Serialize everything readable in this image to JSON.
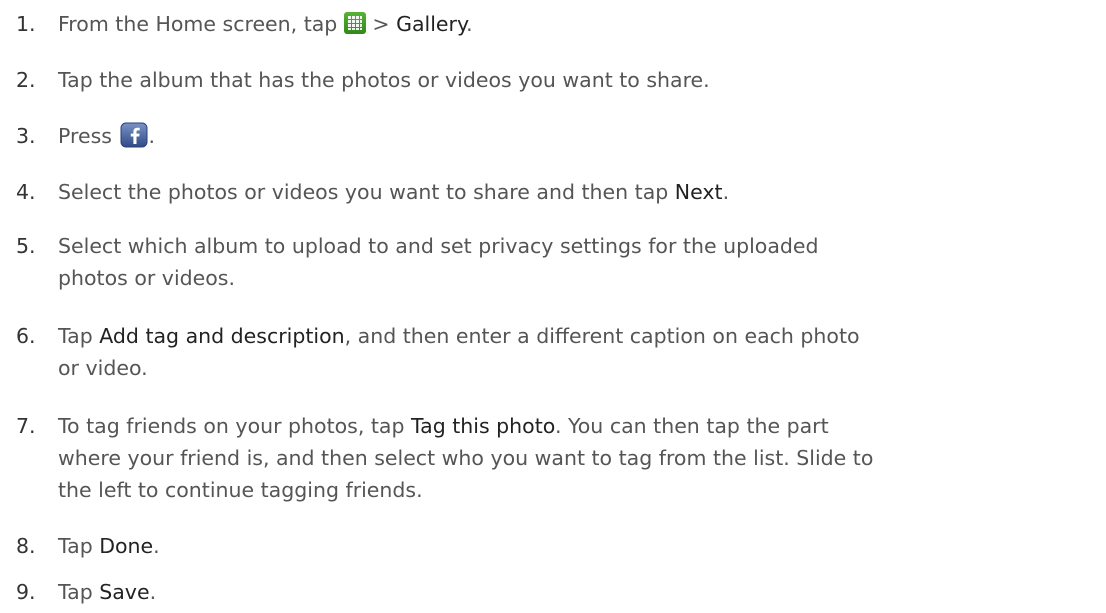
{
  "steps": [
    {
      "num": "1.",
      "t1": "From the Home screen, tap ",
      "icon": "app-grid-icon",
      "t2": " > ",
      "kw1": "Gallery",
      "t3": "."
    },
    {
      "num": "2.",
      "t1": "Tap the album that has the photos or videos you want to share."
    },
    {
      "num": "3.",
      "t1": "Press ",
      "icon": "facebook-icon",
      "t2": "."
    },
    {
      "num": "4.",
      "t1": "Select the photos or videos you want to share and then tap ",
      "kw1": "Next",
      "t2": "."
    },
    {
      "num": "5.",
      "line1": "Select which album to upload to and set privacy settings for the uploaded",
      "line2": "photos or videos."
    },
    {
      "num": "6.",
      "t1": "Tap ",
      "kw1": "Add tag and description",
      "t2": ", and then enter a different caption on each photo",
      "line2": "or video."
    },
    {
      "num": "7.",
      "t1": "To tag friends on your photos, tap ",
      "kw1": "Tag this photo",
      "t2": ". You can then tap the part",
      "line2": "where your friend is, and then select who you want to tag from the list. Slide to",
      "line3": "the left to continue tagging friends."
    },
    {
      "num": "8.",
      "t1": "Tap ",
      "kw1": "Done",
      "t2": "."
    },
    {
      "num": "9.",
      "t1": "Tap ",
      "kw1": "Save",
      "t2": "."
    }
  ],
  "colors": {
    "text": "#555555",
    "keyword": "#222222",
    "grid_icon": "#3c9a24",
    "facebook_icon": "#3b5998"
  }
}
